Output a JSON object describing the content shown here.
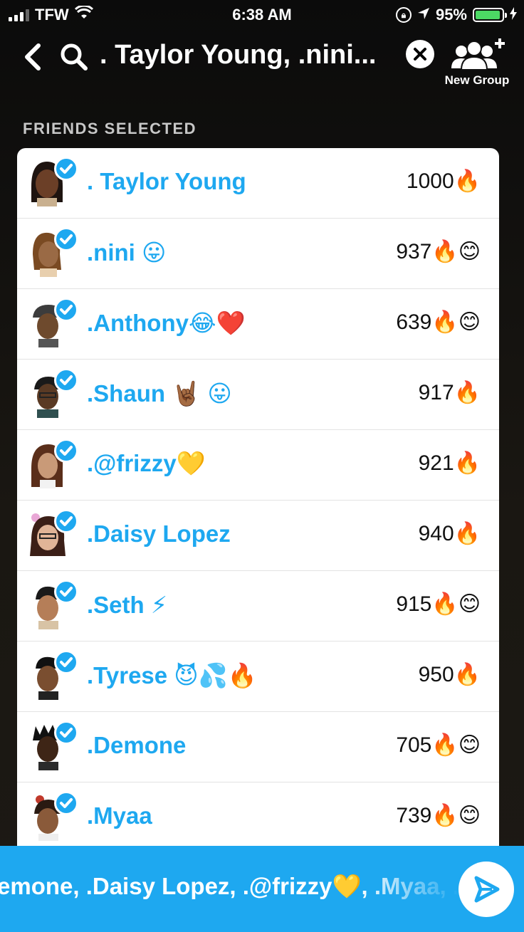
{
  "status": {
    "carrier": "TFW",
    "time": "6:38 AM",
    "battery": "95%",
    "battery_level": 0.95
  },
  "header": {
    "search_text": ". Taylor Young, .nini...",
    "new_group_label": "New Group"
  },
  "section_title": "FRIENDS SELECTED",
  "friends": [
    {
      "name": ". Taylor Young",
      "score": "1000🔥"
    },
    {
      "name": ".nini 😛",
      "score": "937🔥😊"
    },
    {
      "name": ".Anthony😂❤️",
      "score": "639🔥😊"
    },
    {
      "name": ".Shaun 🤘🏾 😛",
      "score": "917🔥"
    },
    {
      "name": ".@frizzy💛",
      "score": "921🔥"
    },
    {
      "name": ".Daisy Lopez",
      "score": "940🔥"
    },
    {
      "name": ".Seth ⚡",
      "score": "915🔥😊"
    },
    {
      "name": ".Tyrese 😈💦🔥",
      "score": "950🔥"
    },
    {
      "name": ".Demone",
      "score": "705🔥😊"
    },
    {
      "name": ".Myaa",
      "score": "739🔥😊"
    }
  ],
  "bottom_bar": {
    "selected_names": "emone, .Daisy Lopez, .@frizzy💛, .Myaa, .S"
  },
  "colors": {
    "accent": "#1ea8f0",
    "battery_green": "#4cd964"
  }
}
